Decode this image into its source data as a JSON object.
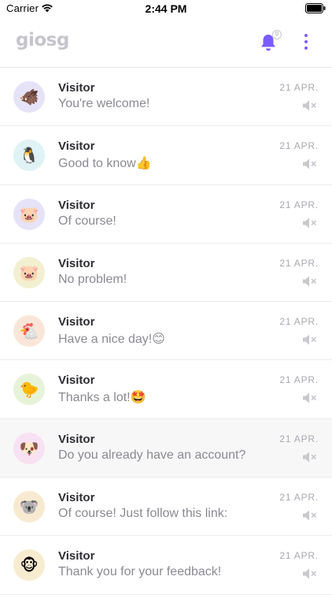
{
  "status_bar": {
    "carrier": "Carrier",
    "time": "2:44 PM"
  },
  "app_bar": {
    "logo": "giosg",
    "notification_badge": "0",
    "accent_color": "#7b5cff"
  },
  "conversations": [
    {
      "name": "Visitor",
      "message": "You're welcome!",
      "date": "21 APR.",
      "avatar_emoji": "🐗",
      "avatar_bg": "#e6e3f8",
      "muted": true
    },
    {
      "name": "Visitor",
      "message": "Good to know👍",
      "date": "21 APR.",
      "avatar_emoji": "🐧",
      "avatar_bg": "#dff2f6",
      "muted": true
    },
    {
      "name": "Visitor",
      "message": "Of course!",
      "date": "21 APR.",
      "avatar_emoji": "🐷",
      "avatar_bg": "#e6e3f8",
      "muted": true
    },
    {
      "name": "Visitor",
      "message": "No problem!",
      "date": "21 APR.",
      "avatar_emoji": "🐷",
      "avatar_bg": "#f3f0d2",
      "muted": true
    },
    {
      "name": "Visitor",
      "message": "Have a nice day!😊",
      "date": "21 APR.",
      "avatar_emoji": "🐔",
      "avatar_bg": "#fae6d8",
      "muted": true
    },
    {
      "name": "Visitor",
      "message": "Thanks a lot!🤩",
      "date": "21 APR.",
      "avatar_emoji": "🐤",
      "avatar_bg": "#e6f3d8",
      "muted": true
    },
    {
      "name": "Visitor",
      "message": "Do you already have an account?",
      "date": "21 APR.",
      "avatar_emoji": "🐶",
      "avatar_bg": "#f8e1f2",
      "muted": true
    },
    {
      "name": "Visitor",
      "message": "Of course! Just follow this link:",
      "date": "21 APR.",
      "avatar_emoji": "🐨",
      "avatar_bg": "#f8ead0",
      "muted": true
    },
    {
      "name": "Visitor",
      "message": "Thank you for your feedback!",
      "date": "21 APR.",
      "avatar_emoji": "🐵",
      "avatar_bg": "#f8ecd0",
      "muted": true
    }
  ]
}
